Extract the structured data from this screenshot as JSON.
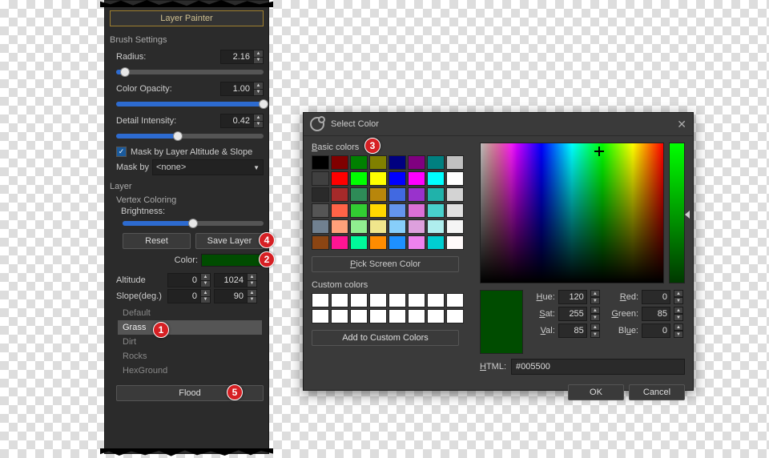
{
  "panel": {
    "tab": "Layer Painter",
    "brush_settings_label": "Brush Settings",
    "radius_label": "Radius:",
    "radius_value": "2.16",
    "radius_pct": 6,
    "opacity_label": "Color Opacity:",
    "opacity_value": "1.00",
    "opacity_pct": 100,
    "detail_label": "Detail Intensity:",
    "detail_value": "0.42",
    "detail_pct": 42,
    "mask_checkbox": "Mask by Layer Altitude & Slope",
    "mask_by_label": "Mask by",
    "mask_by_value": "<none>",
    "layer_label": "Layer",
    "vertex_label": "Vertex Coloring",
    "brightness_label": "Brightness:",
    "brightness_pct": 50,
    "reset_btn": "Reset",
    "save_btn": "Save Layer",
    "color_label": "Color:",
    "altitude_label": "Altitude",
    "altitude_min": "0",
    "altitude_max": "1024",
    "slope_label": "Slope(deg.)",
    "slope_min": "0",
    "slope_max": "90",
    "layers": [
      "Default",
      "Grass",
      "Dirt",
      "Rocks",
      "HexGround"
    ],
    "layer_selected": 1,
    "flood_btn": "Flood"
  },
  "dialog": {
    "title": "Select Color",
    "basic_label_pre": "B",
    "basic_label_post": "asic colors",
    "pick_btn_pre": "P",
    "pick_btn_post": "ick Screen Color",
    "custom_label": "Custom colors",
    "add_btn": "Add to Custom Colors",
    "hue_label": "Hue:",
    "hue_value": "120",
    "sat_label": "Sat:",
    "sat_value": "255",
    "val_label": "Val:",
    "val_value": "85",
    "red_label": "Red:",
    "red_value": "0",
    "green_label": "Green:",
    "green_value": "85",
    "blue_label": "Blue:",
    "blue_value": "0",
    "html_label": "HTML:",
    "html_value": "#005500",
    "ok": "OK",
    "cancel": "Cancel",
    "basic_colors": [
      "#000000",
      "#800000",
      "#008000",
      "#808000",
      "#000080",
      "#800080",
      "#008080",
      "#c0c0c0",
      "#404040",
      "#ff0000",
      "#00ff00",
      "#ffff00",
      "#0000ff",
      "#ff00ff",
      "#00ffff",
      "#ffffff",
      "#2a2a2a",
      "#a52a2a",
      "#2e8b57",
      "#b8860b",
      "#4169e1",
      "#9932cc",
      "#20b2aa",
      "#d3d3d3",
      "#555555",
      "#ff6347",
      "#32cd32",
      "#ffd700",
      "#6495ed",
      "#da70d6",
      "#48d1cc",
      "#e0e0e0",
      "#708090",
      "#ffa07a",
      "#90ee90",
      "#f0e68c",
      "#87cefa",
      "#dda0dd",
      "#afeeee",
      "#f5f5f5",
      "#8b4513",
      "#ff1493",
      "#00fa9a",
      "#ff8c00",
      "#1e90ff",
      "#ee82ee",
      "#00ced1",
      "#fffafa"
    ]
  },
  "badges": {
    "b1": "1",
    "b2": "2",
    "b3": "3",
    "b4": "4",
    "b5": "5"
  }
}
